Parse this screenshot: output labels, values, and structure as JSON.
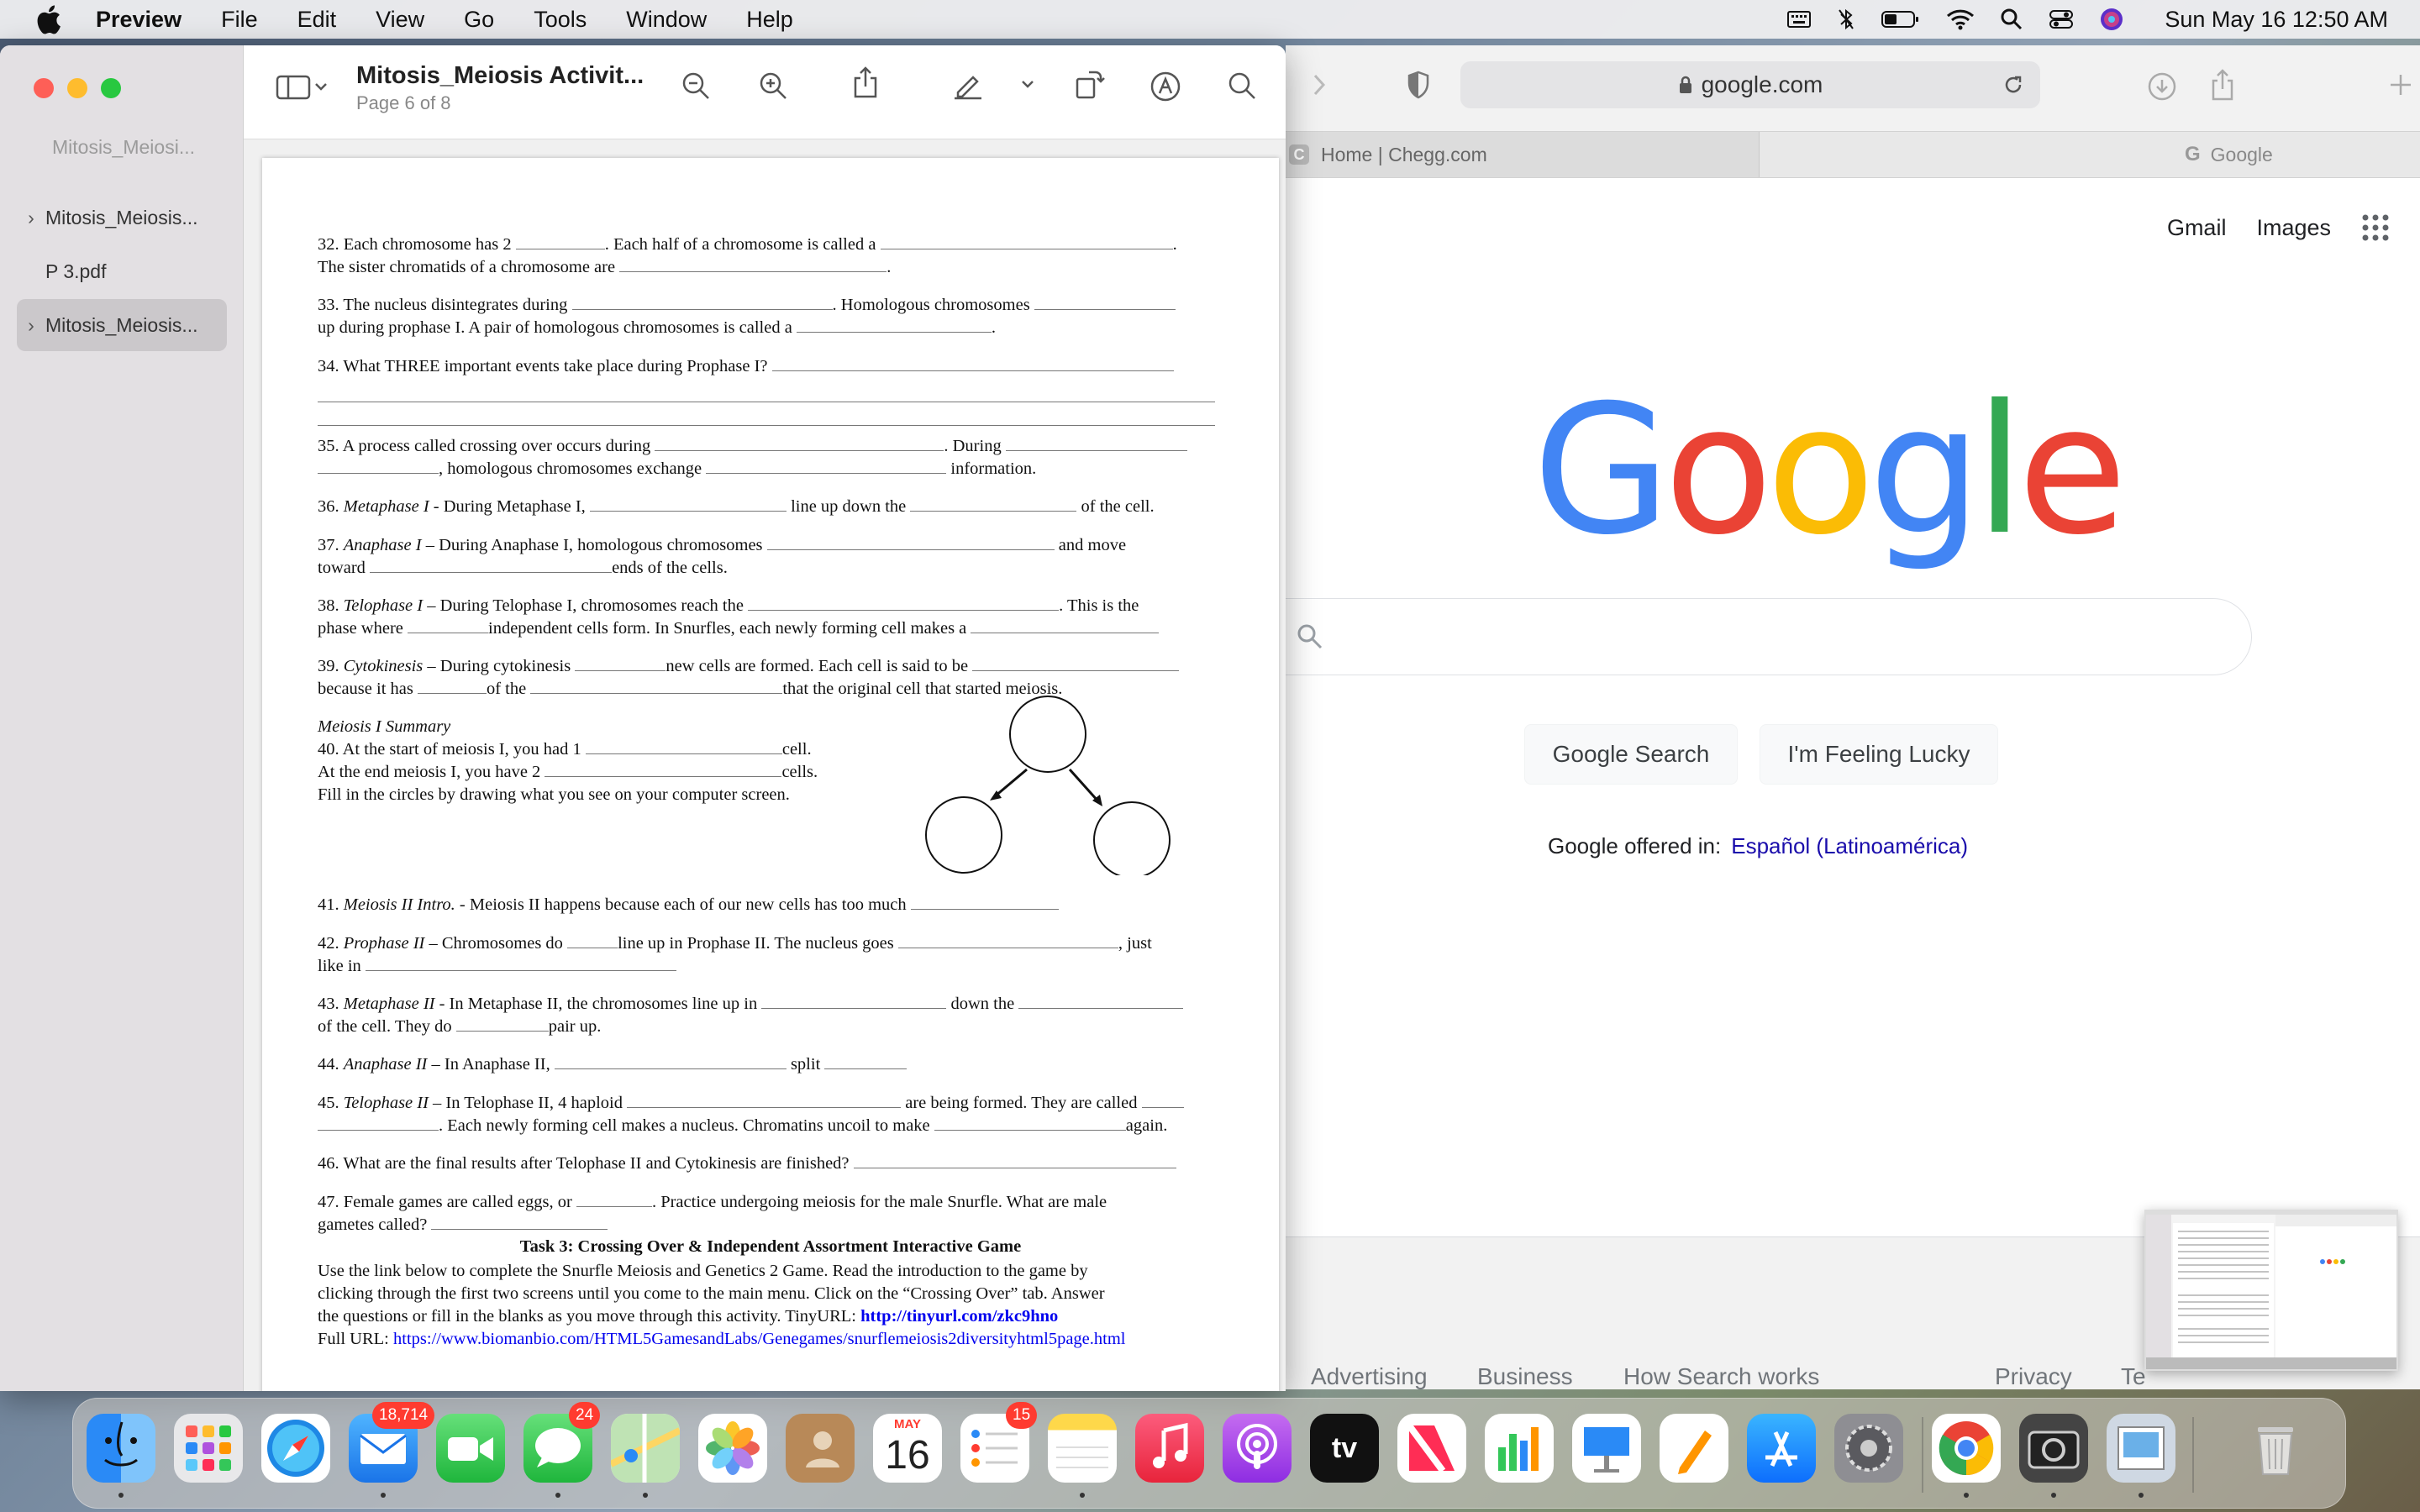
{
  "menubar": {
    "app": "Preview",
    "items": [
      "File",
      "Edit",
      "View",
      "Go",
      "Tools",
      "Window",
      "Help"
    ],
    "clock": "Sun May 16  12:50 AM"
  },
  "preview": {
    "title": "Mitosis_Meiosis Activit...",
    "subtitle": "Page 6 of 8",
    "sidebar": {
      "header": "Mitosis_Meiosi...",
      "items": [
        "Mitosis_Meiosis...",
        "P 3.pdf",
        "Mitosis_Meiosis..."
      ]
    }
  },
  "doc": {
    "q32a": "32. Each chromosome has 2",
    "q32b": ". Each half of a chromosome is called a",
    "q32c": "The sister chromatids of a chromosome are",
    "q33a": "33. The nucleus disintegrates during",
    "q33b": ". Homologous chromosomes",
    "q33c": "up during prophase I. A pair of homologous chromosomes is called a",
    "q34": "34. What THREE important events take place during Prophase I?",
    "q35a": "35. A process called crossing over occurs during",
    "q35b": ". During",
    "q35c": ", homologous chromosomes exchange",
    "q35d": "information.",
    "q36stage": "Metaphase I",
    "q36a": "36. ",
    "q36b": " - During Metaphase I,",
    "q36c": "line up down the",
    "q36d": "of the cell.",
    "q37stage": "Anaphase I",
    "q37a": "37. ",
    "q37b": " – During Anaphase I, homologous chromosomes",
    "q37c": "and move",
    "q37d": "toward",
    "q37e": "ends of the cells.",
    "q38stage": "Telophase I",
    "q38a": "38. ",
    "q38b": " – During Telophase I, chromosomes reach the",
    "q38c": ". This is the",
    "q38d": "phase where",
    "q38e": "independent cells form. In Snurfles, each newly forming cell makes a",
    "q39stage": "Cytokinesis",
    "q39a": "39. ",
    "q39b": " – During cytokinesis",
    "q39c": "new cells are formed. Each cell is said to be",
    "q39d": "because it has",
    "q39e": "of the",
    "q39f": "that the original cell that started meiosis.",
    "summary": "Meiosis I Summary",
    "q40a": "40. At the start of meiosis I, you had 1",
    "q40b": "cell.",
    "q40c": "At the end meiosis I, you have 2",
    "q40d": "cells.",
    "q40e": "Fill in the circles by drawing what you see on your computer screen.",
    "q41stage": "Meiosis II Intro.",
    "q41a": "41. ",
    "q41b": " - Meiosis II happens because each of our new cells has too much",
    "q42stage": "Prophase II",
    "q42a": "42. ",
    "q42b": " – Chromosomes do",
    "q42c": "line up in Prophase II. The nucleus goes",
    "q42d": ", just",
    "q42e": "like in",
    "q43stage": "Metaphase II",
    "q43a": "43. ",
    "q43b": " - In Metaphase II, the chromosomes line up in",
    "q43c": "down the",
    "q43d": "of the cell. They do",
    "q43e": "pair up.",
    "q44stage": "Anaphase II",
    "q44a": "44. ",
    "q44b": " – In Anaphase II,",
    "q44c": "split",
    "q45stage": "Telophase II",
    "q45a": "45. ",
    "q45b": " – In Telophase II, 4 haploid",
    "q45c": "are being formed. They are called",
    "q45d": ". Each newly forming cell makes a nucleus. Chromatins uncoil to make",
    "q45e": "again.",
    "q46": "46. What are the final results after Telophase II and Cytokinesis are finished?",
    "q47a": "47. Female games are called eggs, or",
    "q47b": ". Practice undergoing meiosis for the male Snurfle. What are male",
    "q47c": "gametes called?",
    "task_title": "Task 3: Crossing Over & Independent Assortment Interactive Game",
    "task1": "Use the link below to complete the Snurfle Meiosis and Genetics 2 Game. Read the introduction to the game by",
    "task2": "clicking through the first two screens until you come to the main menu. Click on the “Crossing Over” tab. Answer",
    "task3": "the questions or fill in the blanks as you move through this activity. TinyURL:",
    "tinyurl": "http://tinyurl.com/zkc9hno",
    "task4": "Full URL:",
    "fullurl": "https://www.biomanbio.com/HTML5GamesandLabs/Genegames/snurflemeiosis2diversityhtml5page.html"
  },
  "safari": {
    "url": "google.com",
    "tabs": [
      "Home | Chegg.com",
      "Google"
    ],
    "tab_favicon": "C",
    "tab2_favicon": "G",
    "google": {
      "links": [
        "Gmail",
        "Images"
      ],
      "logo_letters": [
        "G",
        "o",
        "o",
        "g",
        "l",
        "e"
      ],
      "logo_colors": [
        "#4285F4",
        "#EA4335",
        "#FBBC05",
        "#4285F4",
        "#34A853",
        "#EA4335"
      ],
      "search_button": "Google Search",
      "lucky_button": "I'm Feeling Lucky",
      "offered_label": "Google offered in:",
      "offered_lang": "Español (Latinoamérica)",
      "footer": [
        "Advertising",
        "Business",
        "How Search works",
        "Privacy",
        "Te"
      ]
    }
  },
  "dock": {
    "mail_badge": "18,714",
    "messages_badge": "24",
    "reminders_badge": "15",
    "calendar_month": "MAY",
    "calendar_day": "16",
    "tv_label": "tv"
  }
}
